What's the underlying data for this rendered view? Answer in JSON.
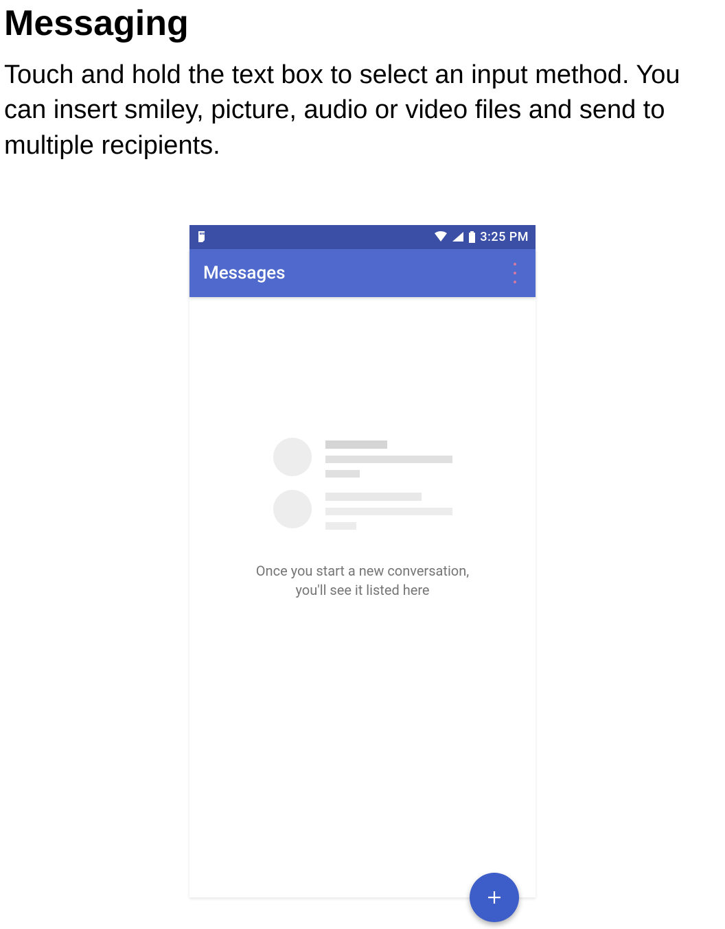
{
  "doc": {
    "title": "Messaging",
    "description": "Touch and hold the text box to select an input method. You can insert smiley, picture, audio or video files and send to multiple recipients."
  },
  "phone": {
    "status_time": "3:25 PM",
    "app_title": "Messages",
    "empty_line1": "Once you start a new conversation,",
    "empty_line2": "you'll see it listed here"
  }
}
